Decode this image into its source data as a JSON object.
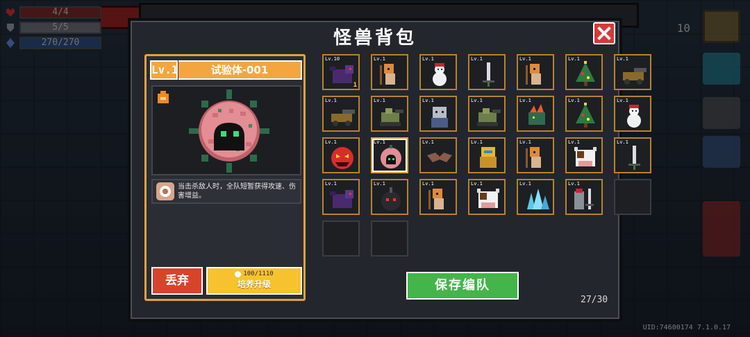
{
  "hud": {
    "hp": "4/4",
    "armor": "5/5",
    "energy": "270/270",
    "coins": "10",
    "uid": "UID:74600174 7.1.0.17"
  },
  "dialog": {
    "title": "怪兽背包",
    "close_icon": "close-icon"
  },
  "selected_pet": {
    "level": "Lv.1",
    "name": "试验体-001",
    "description": "当击杀敌人时，全队短暂获得攻速、伤害增益。",
    "discard_label": "丢弃",
    "upgrade_cost": "100/1110",
    "upgrade_label": "培养升级"
  },
  "inventory": {
    "slots": [
      {
        "level": "Lv.10",
        "icon": "purple-dragon-icon",
        "count": "1"
      },
      {
        "level": "Lv.1",
        "icon": "mummy-knight-icon"
      },
      {
        "level": "Lv.1",
        "icon": "snowman-icon"
      },
      {
        "level": "Lv.1",
        "icon": "sword-icon"
      },
      {
        "level": "Lv.1",
        "icon": "mummy-knight-icon"
      },
      {
        "level": "Lv.1",
        "icon": "christmas-tree-monster-icon"
      },
      {
        "level": "Lv.1",
        "icon": "cannon-cart-icon"
      },
      {
        "level": "Lv.1",
        "icon": "cannon-cart-icon"
      },
      {
        "level": "Lv.1",
        "icon": "green-tank-icon"
      },
      {
        "level": "Lv.1",
        "icon": "ape-warrior-icon"
      },
      {
        "level": "Lv.1",
        "icon": "green-tank-icon"
      },
      {
        "level": "Lv.1",
        "icon": "flame-beast-icon"
      },
      {
        "level": "Lv.1",
        "icon": "christmas-tree-monster-icon"
      },
      {
        "level": "Lv.1",
        "icon": "snowman-icon"
      },
      {
        "level": "Lv.1",
        "icon": "red-demon-ball-icon"
      },
      {
        "level": "Lv.1",
        "icon": "pink-spore-icon"
      },
      {
        "level": "Lv.1",
        "icon": "bat-icon"
      },
      {
        "level": "Lv.1",
        "icon": "gold-robot-icon"
      },
      {
        "level": "Lv.1",
        "icon": "mummy-knight-icon"
      },
      {
        "level": "Lv.1",
        "icon": "cow-icon"
      },
      {
        "level": "Lv.1",
        "icon": "sword-icon"
      },
      {
        "level": "Lv.1",
        "icon": "purple-dragon-icon"
      },
      {
        "level": "Lv.1",
        "icon": "dark-bomb-icon"
      },
      {
        "level": "Lv.1",
        "icon": "mummy-knight-icon"
      },
      {
        "level": "Lv.1",
        "icon": "cow-icon"
      },
      {
        "level": "Lv.1",
        "icon": "ice-crystal-icon"
      },
      {
        "level": "Lv.1",
        "icon": "robot-knight-icon"
      },
      {
        "level": "",
        "icon": ""
      },
      {
        "level": "",
        "icon": ""
      },
      {
        "level": "",
        "icon": ""
      }
    ],
    "selected_index": 15,
    "capacity": "27/30"
  },
  "actions": {
    "save_label": "保存编队"
  },
  "colors": {
    "accent_orange": "#f3a63f",
    "discard_red": "#d8432c",
    "upgrade_yellow": "#f6c22d",
    "save_green": "#43b54a",
    "close_red": "#d83838"
  }
}
